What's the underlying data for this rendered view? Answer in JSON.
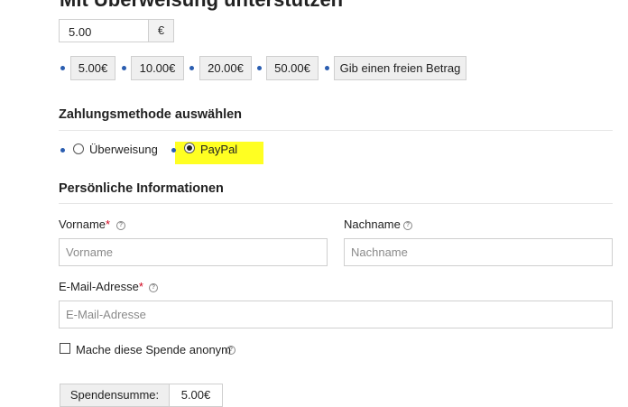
{
  "header": {
    "title": "Mit Überweisung unterstützen"
  },
  "amount": {
    "value": "5.00",
    "currency": "€",
    "presets": [
      "5.00€",
      "10.00€",
      "20.00€",
      "50.00€"
    ],
    "free_amount_label": "Gib einen freien Betrag"
  },
  "payment": {
    "title": "Zahlungsmethode auswählen",
    "options": [
      {
        "label": "Überweisung",
        "selected": false
      },
      {
        "label": "PayPal",
        "selected": true
      }
    ]
  },
  "personal": {
    "title": "Persönliche Informationen",
    "first_name": {
      "label": "Vorname",
      "required": "*",
      "placeholder": "Vorname"
    },
    "last_name": {
      "label": "Nachname",
      "placeholder": "Nachname"
    },
    "email": {
      "label": "E-Mail-Adresse",
      "required": "*",
      "placeholder": "E-Mail-Adresse"
    },
    "anonymous_label": "Mache diese Spende anonym",
    "help_icon": "?"
  },
  "summary": {
    "label": "Spendensumme:",
    "value": "5.00€"
  },
  "colors": {
    "highlight": "#ffff22",
    "bullet": "#2a5db0",
    "required": "#d0021b"
  }
}
